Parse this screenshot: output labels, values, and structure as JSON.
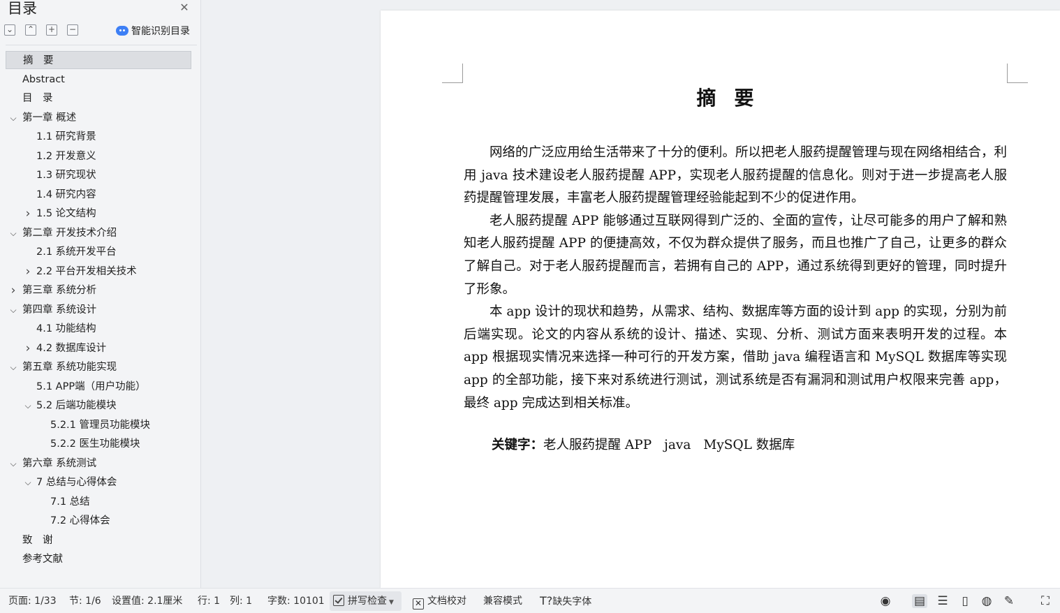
{
  "sidebar": {
    "title": "目录",
    "close_icon": "close-icon",
    "toolbar": {
      "collapse_all": "⌄",
      "expand_up": "⌃",
      "add": "+",
      "remove": "−",
      "smart_toc_label": "智能识别目录"
    },
    "toc": [
      {
        "label": "摘　要",
        "level": 0,
        "chevron": "",
        "active": true
      },
      {
        "label": "Abstract",
        "level": 0,
        "chevron": ""
      },
      {
        "label": "目　录",
        "level": 0,
        "chevron": ""
      },
      {
        "label": "第一章  概述",
        "level": 0,
        "chevron": "expanded"
      },
      {
        "label": "1.1  研究背景",
        "level": 1,
        "chevron": ""
      },
      {
        "label": "1.2 开发意义",
        "level": 1,
        "chevron": ""
      },
      {
        "label": "1.3  研究现状",
        "level": 1,
        "chevron": ""
      },
      {
        "label": "1.4  研究内容",
        "level": 1,
        "chevron": ""
      },
      {
        "label": "1.5 论文结构",
        "level": 1,
        "chevron": "collapsed"
      },
      {
        "label": " 第二章 开发技术介绍",
        "level": 0,
        "chevron": "expanded"
      },
      {
        "label": "2.1  系统开发平台",
        "level": 1,
        "chevron": ""
      },
      {
        "label": "2.2  平台开发相关技术",
        "level": 1,
        "chevron": "collapsed"
      },
      {
        "label": "第三章  系统分析",
        "level": 0,
        "chevron": "collapsed"
      },
      {
        "label": "第四章  系统设计",
        "level": 0,
        "chevron": "expanded"
      },
      {
        "label": "4.1 功能结构",
        "level": 1,
        "chevron": ""
      },
      {
        "label": "4.2  数据库设计",
        "level": 1,
        "chevron": "collapsed"
      },
      {
        "label": "第五章  系统功能实现",
        "level": 0,
        "chevron": "expanded"
      },
      {
        "label": "5.1 APP端（用户功能）",
        "level": 1,
        "chevron": ""
      },
      {
        "label": "5.2 后端功能模块",
        "level": 1,
        "chevron": "expanded"
      },
      {
        "label": "5.2.1 管理员功能模块",
        "level": 2,
        "chevron": ""
      },
      {
        "label": "5.2.2 医生功能模块",
        "level": 2,
        "chevron": ""
      },
      {
        "label": "第六章  系统测试",
        "level": 0,
        "chevron": "expanded"
      },
      {
        "label": "7 总结与心得体会",
        "level": 1,
        "chevron": "expanded"
      },
      {
        "label": "7.1  总结",
        "level": 2,
        "chevron": ""
      },
      {
        "label": "7.2  心得体会",
        "level": 2,
        "chevron": ""
      },
      {
        "label": "致　谢",
        "level": 0,
        "chevron": ""
      },
      {
        "label": "参考文献",
        "level": 0,
        "chevron": ""
      }
    ]
  },
  "document": {
    "heading": "摘要",
    "paragraphs": [
      "网络的广泛应用给生活带来了十分的便利。所以把老人服药提醒管理与现在网络相结合，利用 java 技术建设老人服药提醒 APP，实现老人服药提醒的信息化。则对于进一步提高老人服药提醒管理发展，丰富老人服药提醒管理经验能起到不少的促进作用。",
      "老人服药提醒 APP 能够通过互联网得到广泛的、全面的宣传，让尽可能多的用户了解和熟知老人服药提醒 APP 的便捷高效，不仅为群众提供了服务，而且也推广了自己，让更多的群众了解自己。对于老人服药提醒而言，若拥有自己的 APP，通过系统得到更好的管理，同时提升了形象。",
      "本 app 设计的现状和趋势，从需求、结构、数据库等方面的设计到 app 的实现，分别为前后端实现。论文的内容从系统的设计、描述、实现、分析、测试方面来表明开发的过程。本 app 根据现实情况来选择一种可行的开发方案，借助 java 编程语言和 MySQL 数据库等实现 app 的全部功能，接下来对系统进行测试，测试系统是否有漏洞和测试用户权限来完善 app，最终 app 完成达到相关标准。"
    ],
    "keywords_label": "关键字：",
    "keywords": [
      "老人服药提醒 APP",
      "java",
      "MySQL 数据库"
    ]
  },
  "statusbar": {
    "page": "页面: 1/33",
    "section": "节: 1/6",
    "setting": "设置值: 2.1厘米",
    "row": "行: 1",
    "col": "列: 1",
    "word_count": "字数: 10101",
    "spell_check": "拼写检查",
    "proofread": "文档校对",
    "compat_mode": "兼容模式",
    "missing_fonts": "缺失字体",
    "icons": [
      "eye-icon",
      "page-view-icon",
      "outline-view-icon",
      "read-mode-icon",
      "web-view-icon",
      "pen-icon",
      "fullscreen-icon"
    ]
  }
}
